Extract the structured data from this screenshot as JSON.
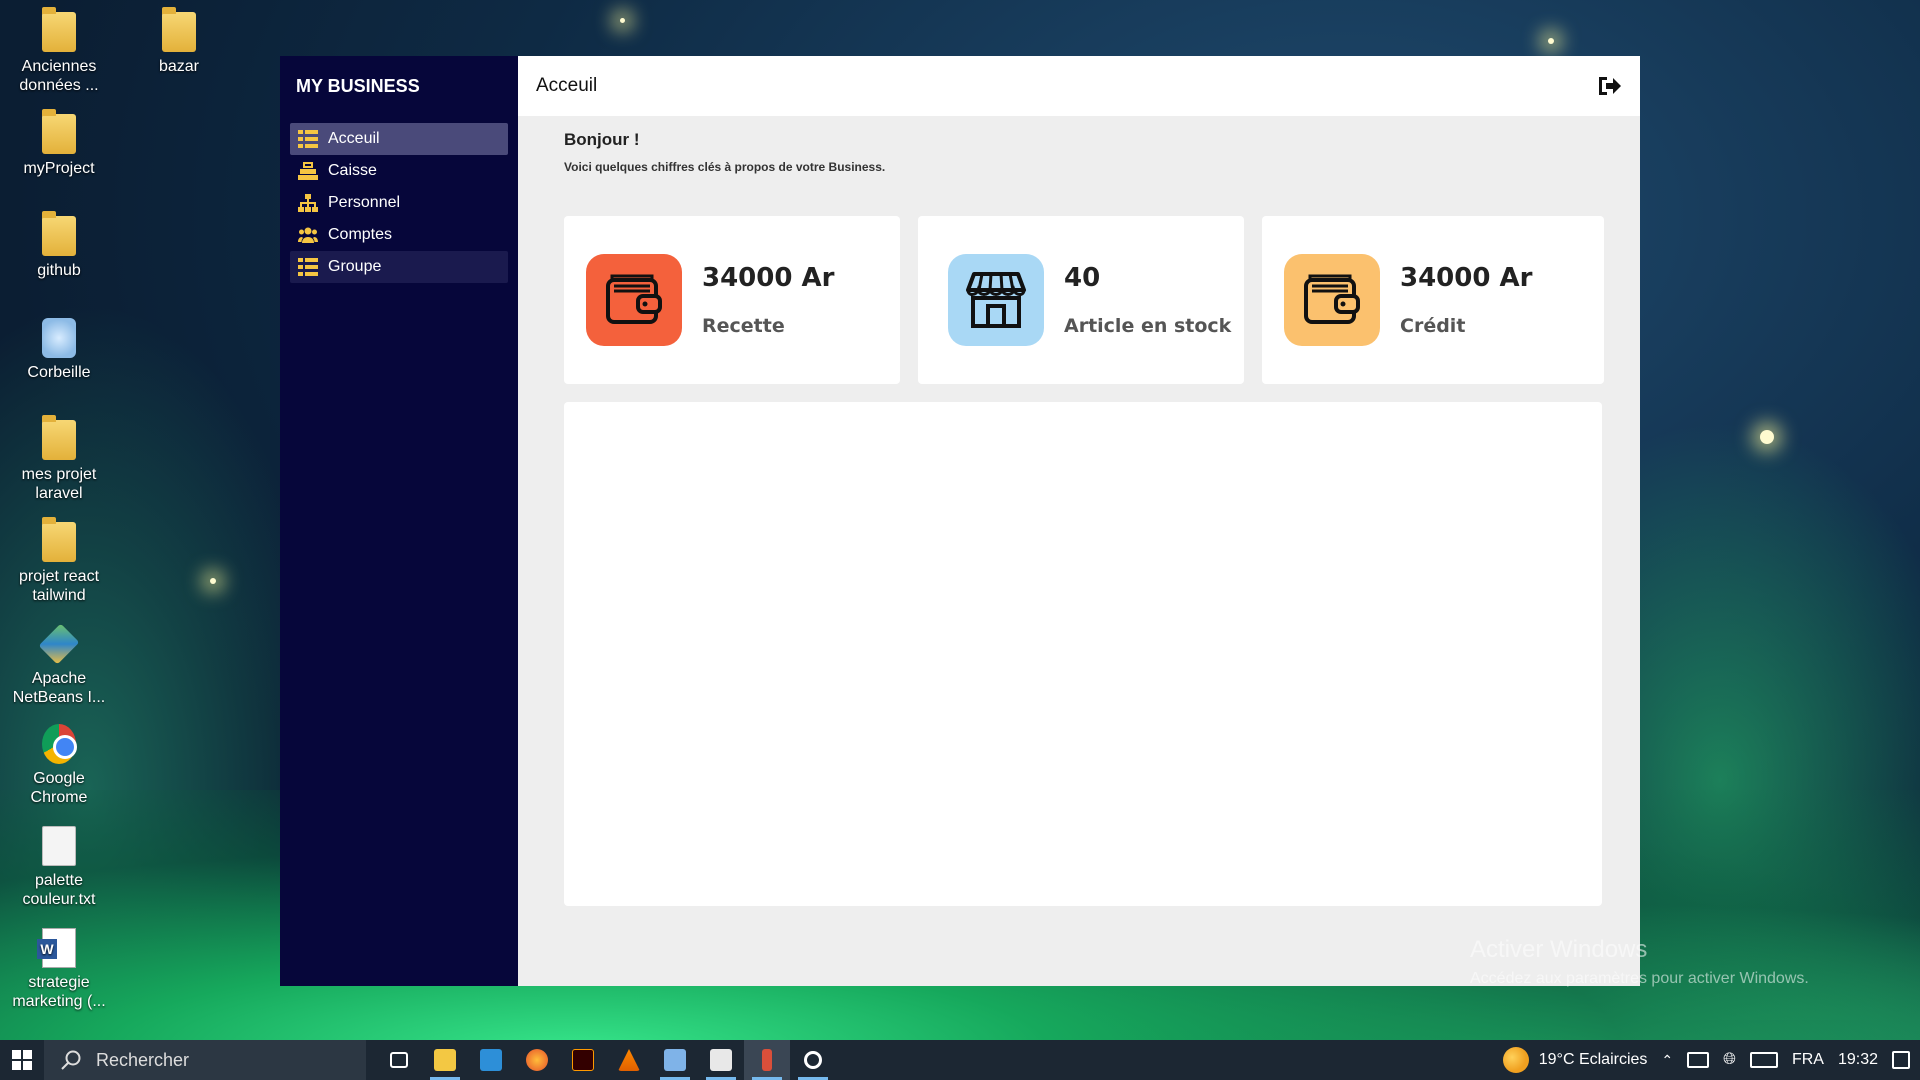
{
  "desktop": {
    "icons": [
      {
        "label": "Anciennes données ...",
        "icon": "folder-icon"
      },
      {
        "label": "bazar",
        "icon": "folder-icon"
      },
      {
        "label": "myProject",
        "icon": "folder-icon"
      },
      {
        "label": "github",
        "icon": "folder-icon"
      },
      {
        "label": "Corbeille",
        "icon": "recycle-bin-icon"
      },
      {
        "label": "mes projet laravel",
        "icon": "folder-icon"
      },
      {
        "label": "projet react tailwind",
        "icon": "folder-icon"
      },
      {
        "label": "Apache NetBeans I...",
        "icon": "netbeans-icon"
      },
      {
        "label": "Google Chrome",
        "icon": "chrome-icon"
      },
      {
        "label": "palette couleur.txt",
        "icon": "text-file-icon"
      },
      {
        "label": "strategie marketing (...",
        "icon": "word-icon"
      }
    ]
  },
  "app": {
    "brand": "MY BUSINESS",
    "nav": [
      {
        "label": "Acceuil",
        "icon": "list-icon"
      },
      {
        "label": "Caisse",
        "icon": "cash-register-icon"
      },
      {
        "label": "Personnel",
        "icon": "org-chart-icon"
      },
      {
        "label": "Comptes",
        "icon": "users-icon"
      },
      {
        "label": "Groupe",
        "icon": "list-icon"
      }
    ],
    "header": {
      "title": "Acceuil",
      "logout_icon": "sign-out-icon"
    },
    "greeting": "Bonjour !",
    "subtitle": "Voici quelques chiffres clés à propos de votre Business.",
    "cards": [
      {
        "value": "34000 Ar",
        "label": "Recette",
        "icon": "wallet-icon",
        "color": "#f4613c"
      },
      {
        "value": "40",
        "label": "Article en stock",
        "icon": "store-icon",
        "color": "#a9d8f5"
      },
      {
        "value": "34000 Ar",
        "label": "Crédit",
        "icon": "wallet-icon",
        "color": "#fbc16e"
      }
    ]
  },
  "watermark": {
    "line1": "Activer Windows",
    "line2": "Accédez aux paramètres pour activer Windows."
  },
  "taskbar": {
    "search_placeholder": "Rechercher",
    "weather": "19°C  Eclaircies",
    "lang": "FRA",
    "time": "19:32"
  }
}
